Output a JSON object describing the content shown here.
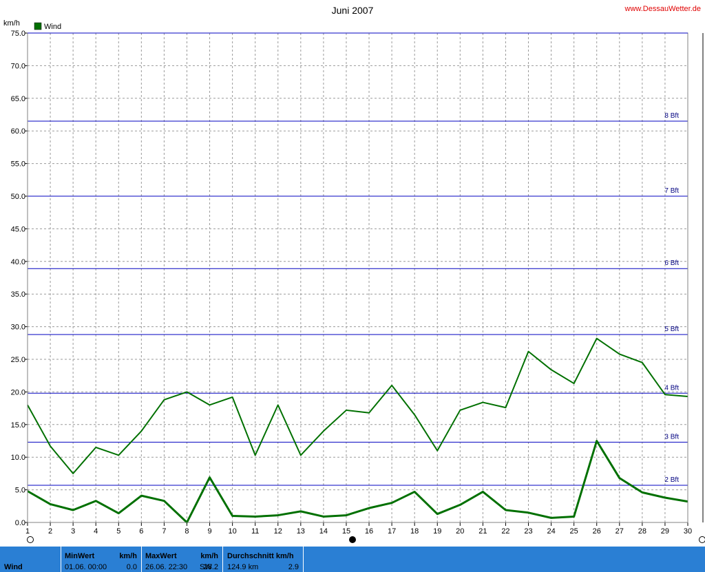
{
  "header": {
    "title": "Juni 2007",
    "site": "www.DessauWetter.de",
    "unit": "km/h",
    "legend_label": "Wind"
  },
  "colors": {
    "series": "#007000",
    "bft_line": "#0000c0",
    "grid": "#999999",
    "footer_bg": "#2a7fd4",
    "site_text": "#e00000"
  },
  "chart_data": {
    "type": "line",
    "title": "Juni 2007",
    "ylabel": "km/h",
    "xlim": [
      1,
      30
    ],
    "ylim": [
      0,
      75
    ],
    "grid": true,
    "legend": "top-left",
    "x": [
      1,
      2,
      3,
      4,
      5,
      6,
      7,
      8,
      9,
      10,
      11,
      12,
      13,
      14,
      15,
      16,
      17,
      18,
      19,
      20,
      21,
      22,
      23,
      24,
      25,
      26,
      27,
      28,
      29,
      30
    ],
    "x_ticks": [
      "1",
      "2",
      "3",
      "4",
      "5",
      "6",
      "7",
      "8",
      "9",
      "10",
      "11",
      "12",
      "13",
      "14",
      "15",
      "16",
      "17",
      "18",
      "19",
      "20",
      "21",
      "22",
      "23",
      "24",
      "25",
      "26",
      "27",
      "28",
      "29",
      "30"
    ],
    "y_ticks": [
      "0.0",
      "5.0",
      "10.0",
      "15.0",
      "20.0",
      "25.0",
      "30.0",
      "35.0",
      "40.0",
      "45.0",
      "50.0",
      "55.0",
      "60.0",
      "65.0",
      "70.0",
      "75.0"
    ],
    "series": [
      {
        "name": "Wind",
        "kind": "max",
        "values": [
          18.0,
          11.7,
          7.5,
          11.5,
          10.3,
          14.0,
          18.8,
          20.0,
          18.0,
          19.2,
          10.3,
          18.0,
          10.3,
          14.0,
          17.2,
          16.8,
          21.0,
          16.5,
          11.0,
          17.2,
          18.4,
          17.6,
          26.2,
          23.4,
          21.3,
          28.2,
          25.8,
          24.5,
          19.6,
          19.3
        ]
      },
      {
        "name": "Wind",
        "kind": "average",
        "values": [
          4.8,
          2.8,
          1.9,
          3.3,
          1.4,
          4.1,
          3.3,
          0.0,
          6.9,
          1.0,
          0.9,
          1.1,
          1.7,
          0.9,
          1.1,
          2.2,
          3.0,
          4.7,
          1.3,
          2.7,
          4.7,
          1.9,
          1.5,
          0.7,
          0.9,
          12.5,
          6.8,
          4.6,
          3.8,
          3.2
        ]
      }
    ],
    "beaufort_lines": [
      {
        "label": "2 Bft",
        "value": 5.7
      },
      {
        "label": "3 Bft",
        "value": 12.3
      },
      {
        "label": "4 Bft",
        "value": 19.8
      },
      {
        "label": "5 Bft",
        "value": 28.8
      },
      {
        "label": "6 Bft",
        "value": 38.9
      },
      {
        "label": "7 Bft",
        "value": 50.0
      },
      {
        "label": "8 Bft",
        "value": 61.5
      }
    ]
  },
  "footer": {
    "series_label": "Wind",
    "min": {
      "header": "MinWert",
      "unit": "km/h",
      "date": "01.06.  00:00",
      "value": "0.0"
    },
    "max": {
      "header": "MaxWert",
      "unit": "km/h",
      "date": "26.06.  22:30",
      "dir": "SW",
      "value": "28.2"
    },
    "avg": {
      "header": "Durchschnitt km/h",
      "distance": "124.9 km",
      "value": "2.9"
    }
  }
}
